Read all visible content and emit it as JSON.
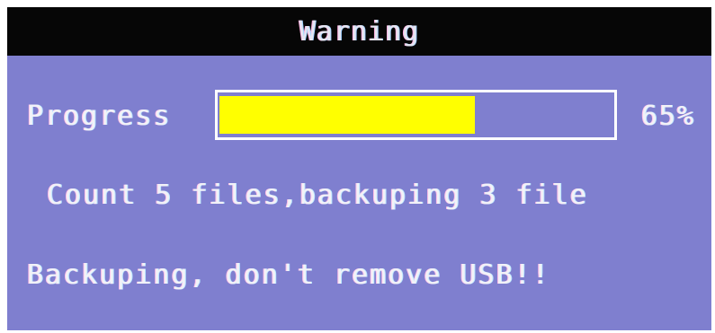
{
  "window": {
    "title": "Warning"
  },
  "progress": {
    "label": "Progress",
    "fraction": 0.65,
    "value_text": "65%"
  },
  "status": {
    "count_text": "Count 5 files,backuping 3 file",
    "warning_text": "Backuping, don't remove USB!!"
  },
  "colors": {
    "panel_bg": "#7f7fcf",
    "title_bar_bg": "#060606",
    "progress_fill": "#ffff00",
    "text": "#f2f2f8"
  }
}
